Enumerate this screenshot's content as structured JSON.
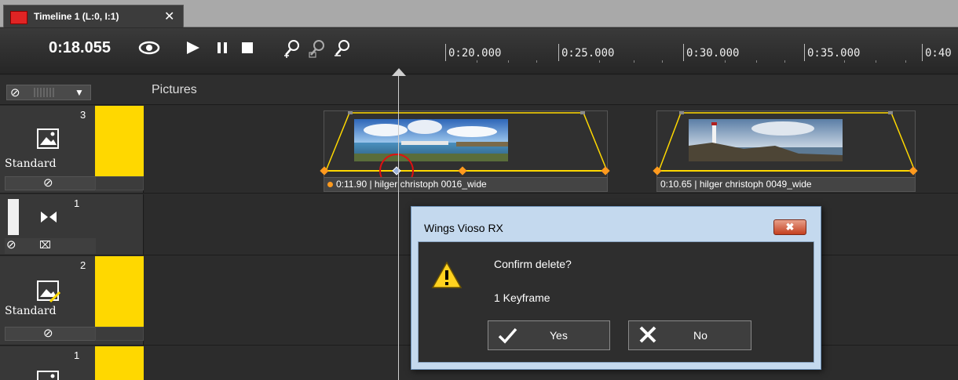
{
  "tab": {
    "title": "Timeline 1 (L:0, I:1)",
    "close_glyph": "✕",
    "color": "#e02424"
  },
  "toolbar": {
    "timecode": "0:18.055",
    "icons": [
      "eye-icon",
      "play-icon",
      "pause-icon",
      "stop-icon",
      "zoom-in-icon",
      "zoom-fit-icon",
      "zoom-out-icon"
    ]
  },
  "ruler": {
    "labels": [
      "0:20.000",
      "0:25.000",
      "0:30.000",
      "0:35.000",
      "0:40"
    ]
  },
  "subheader": {
    "title": "Pictures"
  },
  "tracks": [
    {
      "number": "3",
      "name": "Standard",
      "level": "100 %"
    },
    {
      "number": "1"
    },
    {
      "number": "2",
      "name": "Standard",
      "level": "100 %"
    },
    {
      "number": "1"
    }
  ],
  "clips": [
    {
      "label": "0:11.90 | hilger christoph 0016_wide"
    },
    {
      "label": "0:10.65 | hilger christoph 0049_wide"
    }
  ],
  "dialog": {
    "title": "Wings Vioso RX",
    "message": "Confirm delete?",
    "detail": "1 Keyframe",
    "yes_label": "Yes",
    "no_label": "No",
    "close_glyph": "✖"
  },
  "colors": {
    "level": "#ffd800",
    "keyframe": "#ff9a1e",
    "highlight": "#e01010",
    "accent": "#e02424"
  }
}
